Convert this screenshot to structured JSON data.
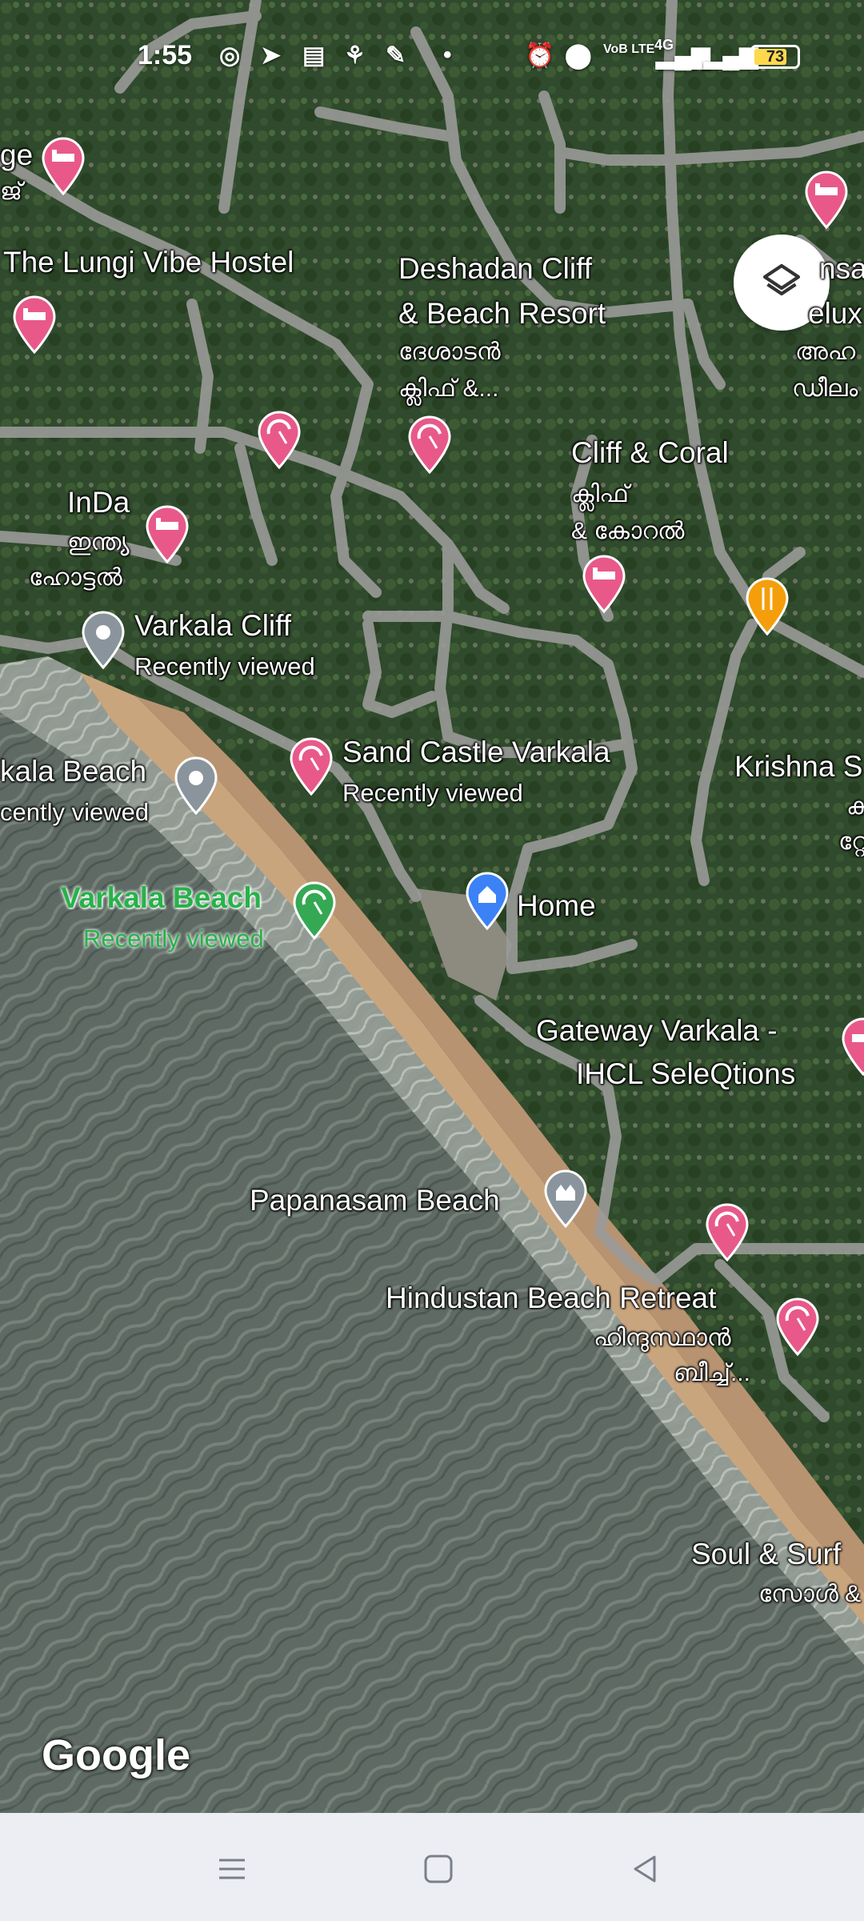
{
  "status_bar": {
    "time": "1:55",
    "battery": "73",
    "network": "4G",
    "volte": "VoB LTE"
  },
  "map": {
    "labels": {
      "hostel_partial": "ge",
      "hostel_partial_ml": "ജ്",
      "lungi_vibe": "The Lungi Vibe Hostel",
      "deshadan_1": "Deshadan Cliff",
      "deshadan_2": "& Beach Resort",
      "deshadan_ml_1": "ദേശാടൻ",
      "deshadan_ml_2": "ക്ലിഫ് &...",
      "right_partial_1": "nsa",
      "right_partial_2": "elux",
      "right_partial_ml_1": "അഹ",
      "right_partial_ml_2": "ഡീലം",
      "cliff_coral": "Cliff & Coral",
      "cliff_coral_ml_1": "ക്ലിഫ്",
      "cliff_coral_ml_2": "& കോറൽ",
      "inda": "InDa",
      "inda_ml_1": "ഇന്ത്യ",
      "inda_ml_2": "ഹോട്ടൽ",
      "varkala_cliff": "Varkala Cliff",
      "varkala_cliff_sub": "Recently viewed",
      "kala_beach": "kala Beach",
      "kala_beach_sub": "cently viewed",
      "sand_castle": "Sand Castle Varkala",
      "sand_castle_sub": "Recently viewed",
      "krishna": "Krishna S",
      "krishna_ml_1": "ക",
      "krishna_ml_2": "റ്റേ",
      "varkala_beach": "Varkala Beach",
      "varkala_beach_sub": "Recently viewed",
      "home": "Home",
      "gateway_1": "Gateway Varkala -",
      "gateway_2": "IHCL SeleQtions",
      "papanasam": "Papanasam Beach",
      "hindustan": "Hindustan Beach Retreat",
      "hindustan_ml_1": "ഹിന്ദുസ്ഥാൻ",
      "hindustan_ml_2": "ബീച്ച്...",
      "soul_surf": "Soul & Surf",
      "soul_surf_ml": "സോൾ &"
    },
    "google_logo": "Google"
  },
  "colors": {
    "hotel_pin": "#e8598a",
    "beach_pin": "#e8598a",
    "food_pin": "#f59e0b",
    "home_pin": "#3b82f6",
    "viewed_pin": "#8a949c",
    "park_pin": "#34a853"
  },
  "nav": {
    "menu_icon": "recents-icon",
    "home_icon": "home-icon",
    "back_icon": "back-icon"
  }
}
